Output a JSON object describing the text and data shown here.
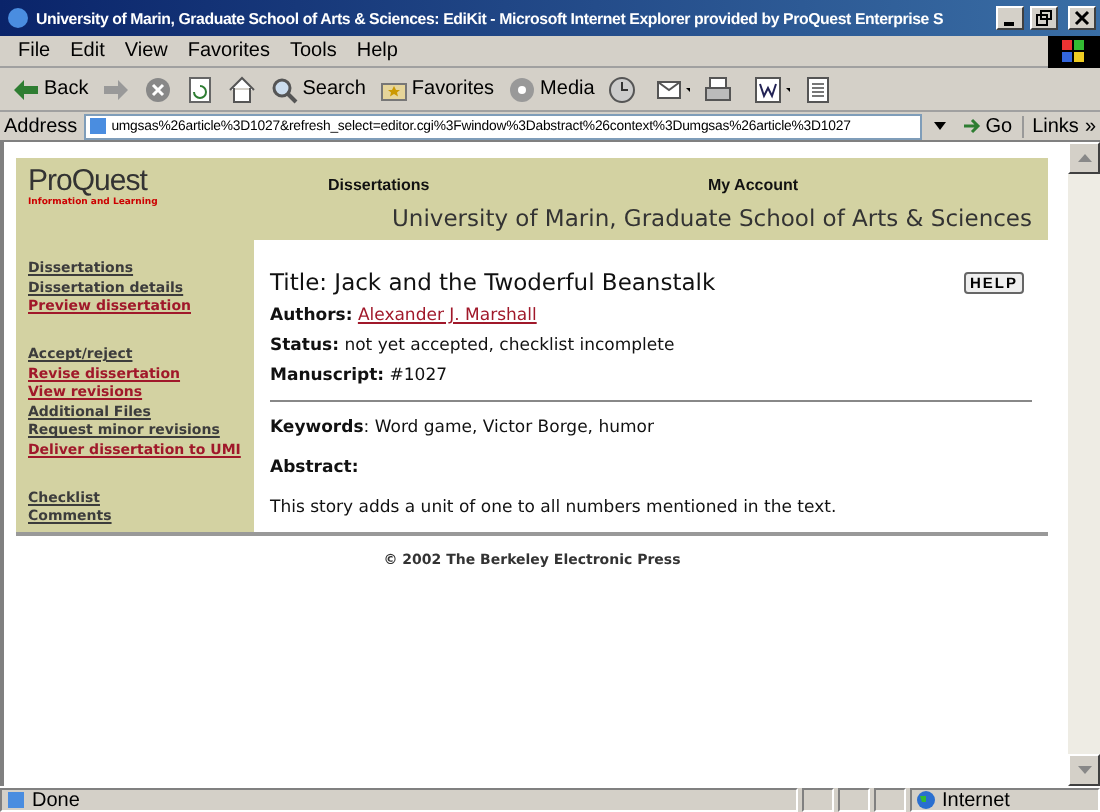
{
  "window": {
    "title": "University of Marin, Graduate School of Arts & Sciences: EdiKit - Microsoft Internet Explorer provided by ProQuest Enterprise S"
  },
  "menu": [
    "File",
    "Edit",
    "View",
    "Favorites",
    "Tools",
    "Help"
  ],
  "toolbar": [
    {
      "kind": "back",
      "label": "Back"
    },
    {
      "kind": "forward"
    },
    {
      "kind": "stop"
    },
    {
      "kind": "refresh"
    },
    {
      "kind": "home"
    },
    {
      "kind": "search",
      "label": "Search"
    },
    {
      "kind": "favorites",
      "label": "Favorites"
    },
    {
      "kind": "media",
      "label": "Media"
    },
    {
      "kind": "history"
    },
    {
      "kind": "mail"
    },
    {
      "kind": "print"
    },
    {
      "kind": "edit"
    },
    {
      "kind": "discuss"
    }
  ],
  "address": {
    "label": "Address",
    "url": "umgsas%26article%3D1027&refresh_select=editor.cgi%3Fwindow%3Dabstract%26context%3Dumgsas%26article%3D1027",
    "go": "Go",
    "links": "Links",
    "more": "»"
  },
  "header": {
    "logo": "ProQuest",
    "logo_sub": "Information and Learning",
    "nav": [
      "Dissertations",
      "My Account"
    ],
    "school": "University of Marin, Graduate School of Arts & Sciences"
  },
  "sidebar": [
    [
      {
        "label": "Dissertations",
        "visited": false
      },
      {
        "label": "Dissertation details",
        "visited": false
      },
      {
        "label": "Preview dissertation",
        "visited": true
      }
    ],
    [
      {
        "label": "Accept/reject",
        "visited": false
      },
      {
        "label": "Revise dissertation",
        "visited": true
      },
      {
        "label": "View revisions",
        "visited": true
      },
      {
        "label": "Additional Files",
        "visited": false
      },
      {
        "label": "Request minor revisions",
        "visited": false
      },
      {
        "label": "Deliver dissertation to UMI",
        "visited": true
      }
    ],
    [
      {
        "label": "Checklist",
        "visited": false
      },
      {
        "label": "Comments",
        "visited": false
      }
    ]
  ],
  "main": {
    "title": "Title: Jack and the Twoderful Beanstalk",
    "help": "HELP",
    "authors_label": "Authors:",
    "author": "Alexander J. Marshall",
    "status_label": "Status:",
    "status": "not yet accepted, checklist incomplete",
    "manuscript_label": "Manuscript:",
    "manuscript": "#1027",
    "keywords_label": "Keywords",
    "keywords": ": Word game, Victor Borge, humor",
    "abstract_label": "Abstract:",
    "abstract": "This story adds a unit of one to all numbers mentioned in the text."
  },
  "footer": "© 2002 The Berkeley Electronic Press",
  "status_bar": {
    "text": "Done",
    "zone": "Internet"
  }
}
